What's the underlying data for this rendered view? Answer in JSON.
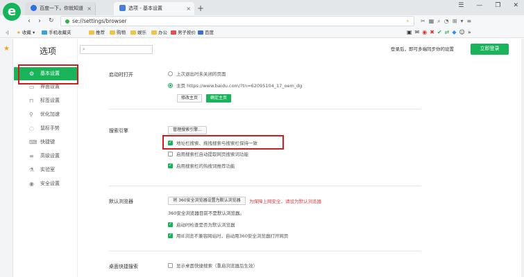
{
  "browser": {
    "logo_letter": "e",
    "tabs": [
      {
        "title": "百度一下，你就知道",
        "close": "×"
      },
      {
        "title": "选项 - 基本设置",
        "close": "×"
      }
    ],
    "new_tab": "+",
    "window_controls": [
      "☰",
      "—",
      "❐",
      "✕"
    ],
    "url": "se://settings/browser",
    "bookmarks_label": "收藏",
    "bookmarks": [
      "手机收藏夹",
      "推荐",
      "购物",
      "娱乐",
      "办公",
      "男子按价",
      "百度"
    ]
  },
  "sidebar": {
    "title": "选项",
    "items": [
      {
        "label": "基本设置",
        "icon": "gear-icon",
        "glyph": "⚙"
      },
      {
        "label": "界面设置",
        "icon": "window-icon",
        "glyph": "▭"
      },
      {
        "label": "标签设置",
        "icon": "tag-icon",
        "glyph": "⊓"
      },
      {
        "label": "优化加速",
        "icon": "rocket-icon",
        "glyph": "⚲"
      },
      {
        "label": "鼠标手势",
        "icon": "mouse-icon",
        "glyph": "◌"
      },
      {
        "label": "快捷键",
        "icon": "keyboard-icon",
        "glyph": "⌨"
      },
      {
        "label": "高级设置",
        "icon": "sliders-icon",
        "glyph": "≡"
      },
      {
        "label": "实验室",
        "icon": "lab-icon",
        "glyph": "⚗"
      },
      {
        "label": "安全设置",
        "icon": "shield-icon",
        "glyph": "◉"
      }
    ]
  },
  "top": {
    "search_placeholder": "",
    "login_hint": "登录后，即可多端同步你的设置",
    "login_button": "立即登录"
  },
  "startup": {
    "heading": "启动时打开",
    "option_restore": "上次退出时未关闭的页面",
    "option_home": "主页  https://www.baidu.com/?tn=62095104_17_oem_dg",
    "btn_edit_home": "修改主页",
    "btn_confirm_home": "确定主页"
  },
  "search": {
    "heading": "搜索引擎",
    "btn_manage": "管理搜索引擎...",
    "opt_address_bar": "地址栏搜索、拖拽搜索与搜索栏保持一致",
    "opt_auto_fetch": "启用搜索栏自动提取网页搜索词功能",
    "opt_hot_words": "启用搜索栏的热搜词推荐功能"
  },
  "default_browser": {
    "heading": "默认浏览器",
    "btn_set_default": "将 360安全浏览器设置为默认浏览器",
    "warning": "为保障上网安全，请设为默认浏览器",
    "status": "360安全浏览器目前不是默认浏览器。",
    "opt_check_startup": "启动时检查是否为默认浏览器",
    "opt_ie_compat": "用IE浏览不兼容网站时，自动用360安全浏览器打开网页"
  },
  "desktop_search": {
    "heading": "桌面快捷搜索",
    "opt_show": "显示桌面快捷搜索（重启浏览器后生效）"
  },
  "colors": {
    "accent": "#19b35a",
    "highlight_box": "#d21b1b",
    "warning": "#e03c3c"
  }
}
